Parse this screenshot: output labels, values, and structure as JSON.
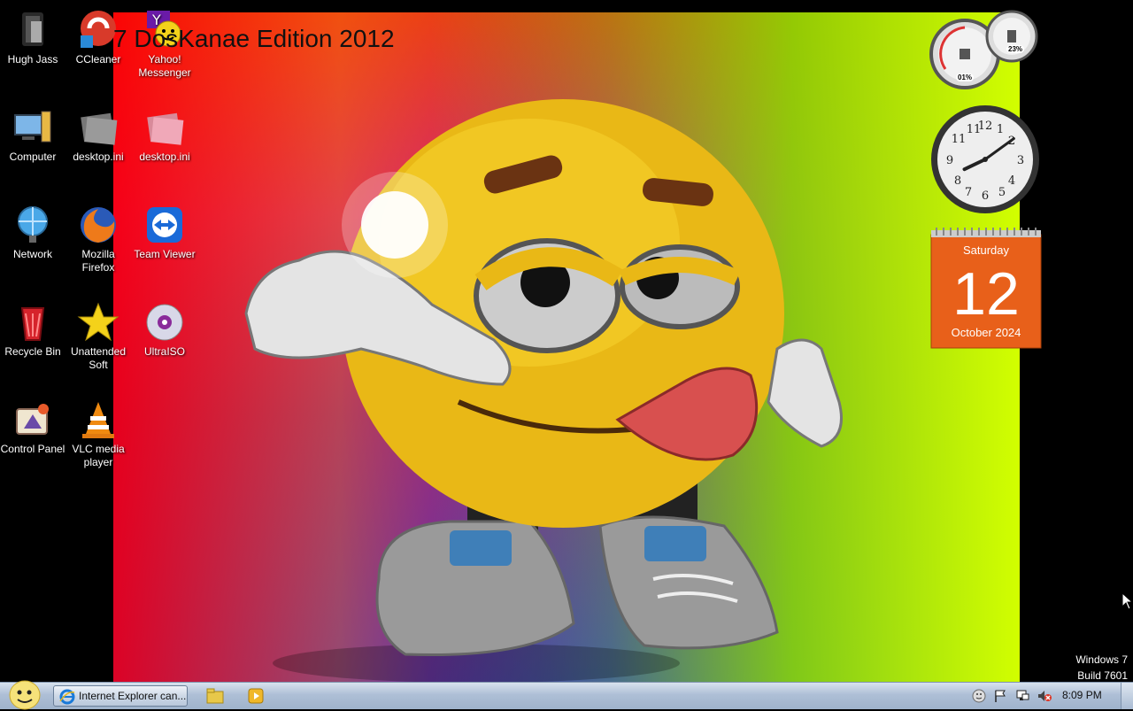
{
  "wallpaper": {
    "caption": "7 DosKanae Edition 2012"
  },
  "desktop_icons": [
    {
      "label": "Hugh Jass",
      "icon": "user-folder-icon"
    },
    {
      "label": "CCleaner",
      "icon": "ccleaner-icon"
    },
    {
      "label": "Yahoo! Messenger",
      "icon": "yahoo-messenger-icon"
    },
    {
      "label": "Computer",
      "icon": "computer-icon"
    },
    {
      "label": "desktop.ini",
      "icon": "ini-file-icon"
    },
    {
      "label": "desktop.ini",
      "icon": "ini-file-icon"
    },
    {
      "label": "Network",
      "icon": "network-icon"
    },
    {
      "label": "Mozilla Firefox",
      "icon": "firefox-icon"
    },
    {
      "label": "Team Viewer",
      "icon": "teamviewer-icon"
    },
    {
      "label": "Recycle Bin",
      "icon": "recycle-bin-icon"
    },
    {
      "label": "Unattended Soft",
      "icon": "star-icon"
    },
    {
      "label": "UltraISO",
      "icon": "disc-icon"
    },
    {
      "label": "Control Panel",
      "icon": "control-panel-icon"
    },
    {
      "label": "VLC media player",
      "icon": "vlc-icon"
    }
  ],
  "gadgets": {
    "cpu_meter": {
      "cpu": "01%",
      "memory": "23%"
    },
    "clock": {
      "hour": 8,
      "minute": 9
    },
    "calendar": {
      "weekday": "Saturday",
      "day": "12",
      "month_year": "October 2024"
    }
  },
  "watermark": {
    "line1": "Windows 7",
    "line2": "Build 7601"
  },
  "taskbar": {
    "task_label": "Internet Explorer can...",
    "quick_launch": [
      "explorer-folder-icon",
      "media-player-icon"
    ],
    "tray_icons": [
      "smiley-icon",
      "action-center-flag-icon",
      "network-icon",
      "volume-muted-icon"
    ],
    "clock": "8:09 PM"
  },
  "colors": {
    "taskbar": "#aebfd6",
    "calendar": "#e8601a",
    "icon_label": "#ffffff"
  }
}
